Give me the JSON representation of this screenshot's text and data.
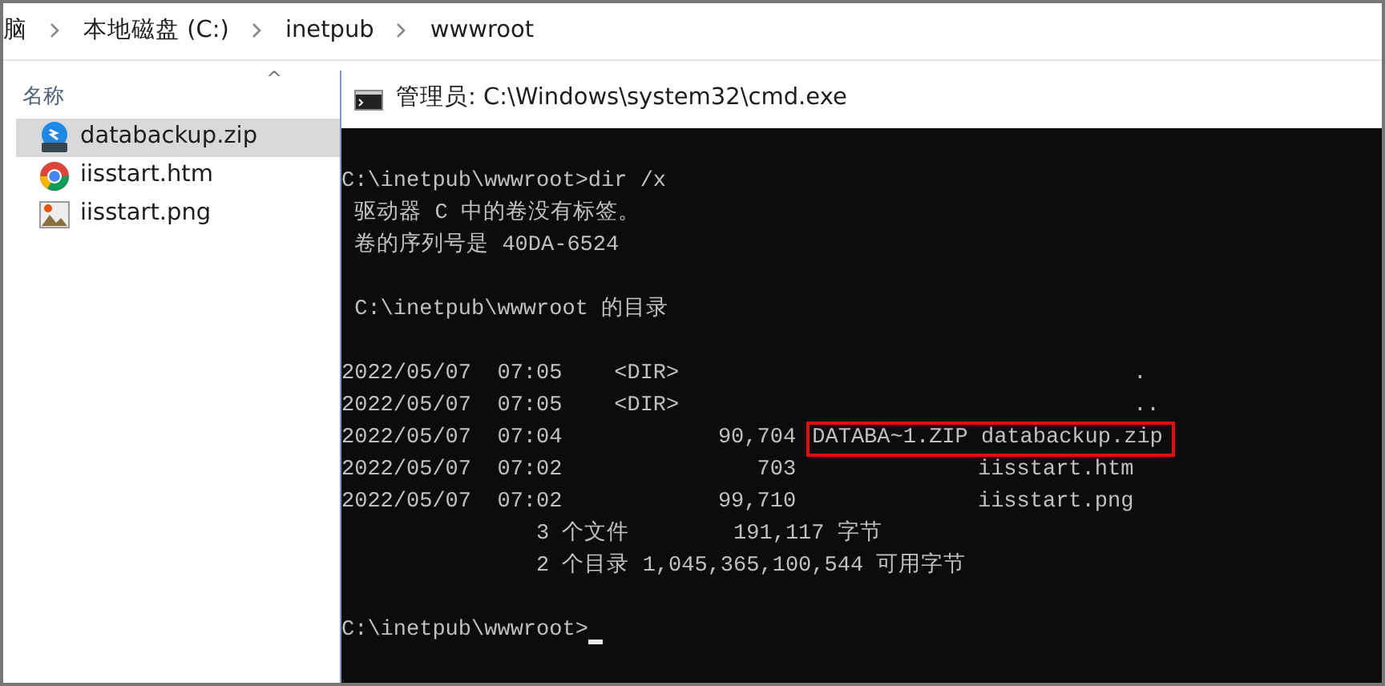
{
  "breadcrumb": [
    "脑",
    "本地磁盘 (C:)",
    "inetpub",
    "wwwroot"
  ],
  "file_list": {
    "column_header": "名称",
    "sort_indicator": "^",
    "files": [
      {
        "name": "databackup.zip",
        "kind": "zip",
        "selected": true
      },
      {
        "name": "iisstart.htm",
        "kind": "htm",
        "selected": false
      },
      {
        "name": "iisstart.png",
        "kind": "png",
        "selected": false
      }
    ]
  },
  "console_window": {
    "title": "管理员: C:\\Windows\\system32\\cmd.exe",
    "lines": [
      {
        "kind": "blank"
      },
      {
        "kind": "text",
        "text": "C:\\inetpub\\wwwroot>dir /x"
      },
      {
        "kind": "text",
        "text": " 驱动器 C 中的卷没有标签。"
      },
      {
        "kind": "text",
        "text": " 卷的序列号是 40DA-6524"
      },
      {
        "kind": "blank"
      },
      {
        "kind": "text",
        "text": " C:\\inetpub\\wwwroot 的目录"
      },
      {
        "kind": "blank"
      },
      {
        "kind": "text",
        "text": "2022/05/07  07:05    <DIR>                                   ."
      },
      {
        "kind": "text",
        "text": "2022/05/07  07:05    <DIR>                                   .."
      },
      {
        "kind": "text",
        "text": "2022/05/07  07:04            90,704 ",
        "boxed": "DATABA~1.ZIP databackup.zip"
      },
      {
        "kind": "text",
        "text": "2022/05/07  07:02               703              iisstart.htm"
      },
      {
        "kind": "text",
        "text": "2022/05/07  07:02            99,710              iisstart.png"
      },
      {
        "kind": "text",
        "text": "               3 个文件        191,117 字节"
      },
      {
        "kind": "text",
        "text": "               2 个目录 1,045,365,100,544 可用字节"
      },
      {
        "kind": "blank"
      },
      {
        "kind": "text",
        "text": "C:\\inetpub\\wwwroot>",
        "cursor": true
      }
    ]
  }
}
